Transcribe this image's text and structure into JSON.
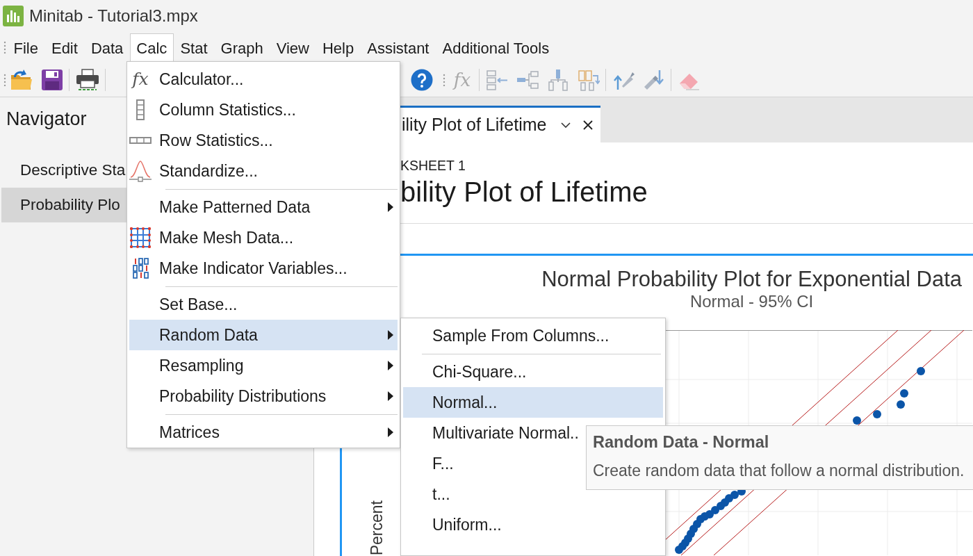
{
  "window": {
    "title": "Minitab - Tutorial3.mpx"
  },
  "menu_bar": [
    {
      "label": "File",
      "selected": false
    },
    {
      "label": "Edit",
      "selected": false
    },
    {
      "label": "Data",
      "selected": false
    },
    {
      "label": "Calc",
      "selected": true
    },
    {
      "label": "Stat",
      "selected": false
    },
    {
      "label": "Graph",
      "selected": false
    },
    {
      "label": "View",
      "selected": false
    },
    {
      "label": "Help",
      "selected": false
    },
    {
      "label": "Assistant",
      "selected": false
    },
    {
      "label": "Additional Tools",
      "selected": false
    }
  ],
  "toolbar": {
    "function_symbol": "fx"
  },
  "navigator": {
    "title": "Navigator",
    "items": [
      {
        "label": "Descriptive Sta",
        "selected": false
      },
      {
        "label": "Probability Plo",
        "selected": true
      }
    ]
  },
  "output_tabs": [
    {
      "label": "ility Plot of Lifetime",
      "selected": true
    }
  ],
  "output": {
    "worksheet": "KSHEET 1",
    "heading": "bility Plot of Lifetime"
  },
  "graph": {
    "title": "Normal Probability Plot for Exponential Data",
    "subtitle": "Normal - 95% CI",
    "y_axis_label": "Percent"
  },
  "calc_menu": {
    "groups": [
      {
        "items": [
          {
            "label": "Calculator...",
            "symbol": "fx",
            "has_submenu": false,
            "selected": false
          },
          {
            "label": "Column Statistics...",
            "has_submenu": false,
            "selected": false
          },
          {
            "label": "Row Statistics...",
            "has_submenu": false,
            "selected": false
          },
          {
            "label": "Standardize...",
            "has_submenu": false,
            "selected": false
          }
        ]
      },
      {
        "items": [
          {
            "label": "Make Patterned Data",
            "has_submenu": true,
            "selected": false
          },
          {
            "label": "Make Mesh Data...",
            "has_submenu": false,
            "selected": false
          },
          {
            "label": "Make Indicator Variables...",
            "has_submenu": false,
            "selected": false
          }
        ]
      },
      {
        "items": [
          {
            "label": "Set Base...",
            "has_submenu": false,
            "selected": false
          },
          {
            "label": "Random Data",
            "has_submenu": true,
            "selected": true
          },
          {
            "label": "Resampling",
            "has_submenu": true,
            "selected": false
          },
          {
            "label": "Probability Distributions",
            "has_submenu": true,
            "selected": false
          }
        ]
      },
      {
        "items": [
          {
            "label": "Matrices",
            "has_submenu": true,
            "selected": false
          }
        ]
      }
    ]
  },
  "random_data_menu": {
    "groups": [
      {
        "items": [
          {
            "label": "Sample From Columns...",
            "has_submenu": false,
            "selected": false
          }
        ]
      },
      {
        "items": [
          {
            "label": "Chi-Square...",
            "has_submenu": false,
            "selected": false
          },
          {
            "label": "Normal...",
            "has_submenu": false,
            "selected": true
          },
          {
            "label": "Multivariate Normal..",
            "has_submenu": false,
            "selected": false
          },
          {
            "label": "F...",
            "has_submenu": false,
            "selected": false
          },
          {
            "label": "t...",
            "has_submenu": false,
            "selected": false
          },
          {
            "label": "Uniform...",
            "has_submenu": false,
            "selected": false
          }
        ]
      }
    ]
  },
  "tooltip": {
    "title": "Random Data - Normal",
    "text": "Create random data that follow a normal distribution."
  }
}
